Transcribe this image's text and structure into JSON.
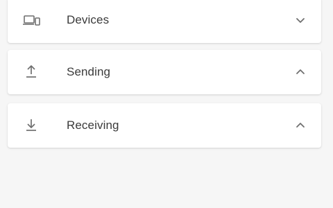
{
  "panels": [
    {
      "label": "Devices",
      "icon": "devices-icon",
      "state": "collapsed"
    },
    {
      "label": "Sending",
      "icon": "upload-icon",
      "state": "expanded"
    },
    {
      "label": "Receiving",
      "icon": "download-icon",
      "state": "expanded"
    }
  ],
  "colors": {
    "background": "#f6f6f6",
    "panel": "#ffffff",
    "text": "#3a3a3a",
    "icon": "#6f6f6f"
  }
}
